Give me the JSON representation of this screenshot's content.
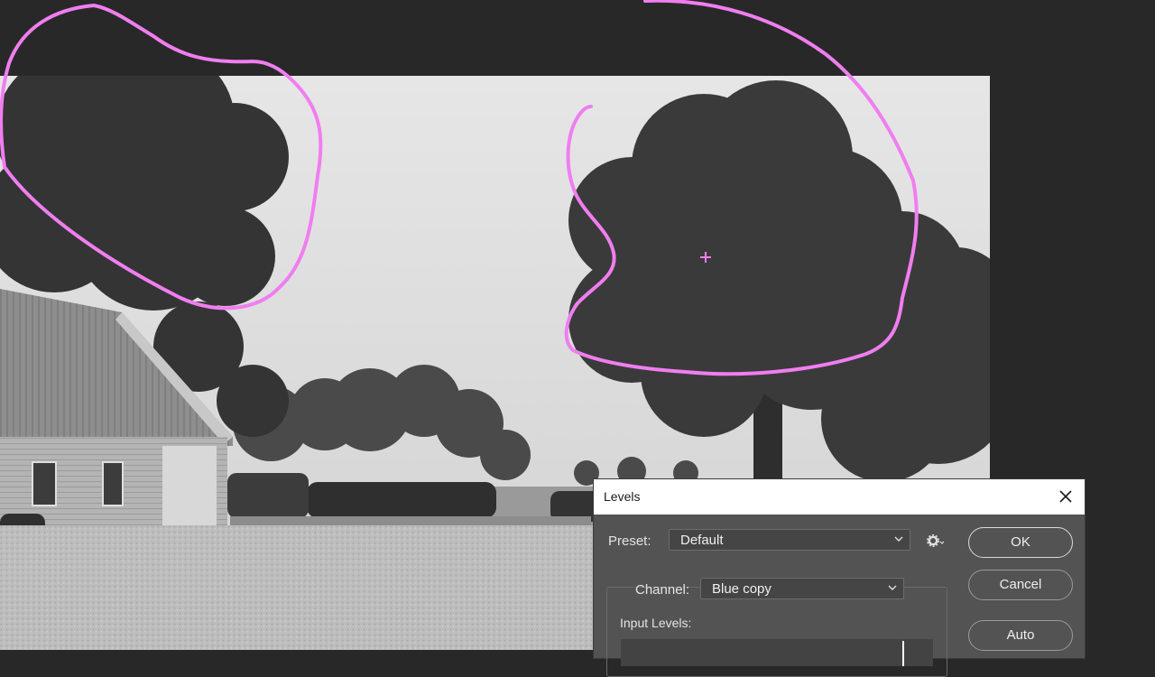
{
  "dialog": {
    "title": "Levels",
    "preset_label": "Preset:",
    "preset_value": "Default",
    "channel_label": "Channel:",
    "channel_value": "Blue copy",
    "input_levels_label": "Input Levels:",
    "buttons": {
      "ok": "OK",
      "cancel": "Cancel",
      "auto": "Auto"
    }
  },
  "icons": {
    "close": "close-icon",
    "preset_options": "gear-icon",
    "dropdown": "chevron-down-icon"
  },
  "colors": {
    "workspace": "#282828",
    "dialog_bg": "#535353",
    "annotation": "#f07ef0"
  }
}
